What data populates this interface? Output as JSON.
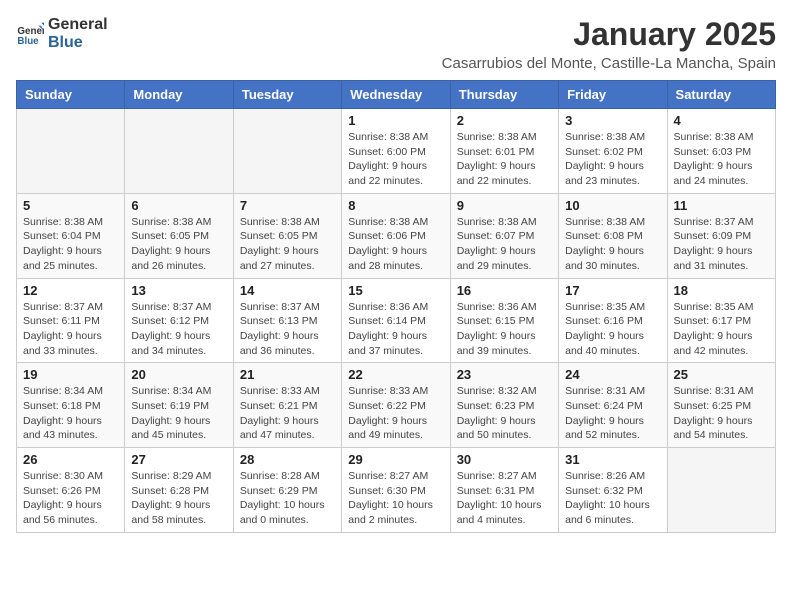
{
  "header": {
    "logo_line1": "General",
    "logo_line2": "Blue",
    "month": "January 2025",
    "location": "Casarrubios del Monte, Castille-La Mancha, Spain"
  },
  "weekdays": [
    "Sunday",
    "Monday",
    "Tuesday",
    "Wednesday",
    "Thursday",
    "Friday",
    "Saturday"
  ],
  "weeks": [
    [
      {
        "day": "",
        "sunrise": "",
        "sunset": "",
        "daylight": ""
      },
      {
        "day": "",
        "sunrise": "",
        "sunset": "",
        "daylight": ""
      },
      {
        "day": "",
        "sunrise": "",
        "sunset": "",
        "daylight": ""
      },
      {
        "day": "1",
        "sunrise": "Sunrise: 8:38 AM",
        "sunset": "Sunset: 6:00 PM",
        "daylight": "Daylight: 9 hours and 22 minutes."
      },
      {
        "day": "2",
        "sunrise": "Sunrise: 8:38 AM",
        "sunset": "Sunset: 6:01 PM",
        "daylight": "Daylight: 9 hours and 22 minutes."
      },
      {
        "day": "3",
        "sunrise": "Sunrise: 8:38 AM",
        "sunset": "Sunset: 6:02 PM",
        "daylight": "Daylight: 9 hours and 23 minutes."
      },
      {
        "day": "4",
        "sunrise": "Sunrise: 8:38 AM",
        "sunset": "Sunset: 6:03 PM",
        "daylight": "Daylight: 9 hours and 24 minutes."
      }
    ],
    [
      {
        "day": "5",
        "sunrise": "Sunrise: 8:38 AM",
        "sunset": "Sunset: 6:04 PM",
        "daylight": "Daylight: 9 hours and 25 minutes."
      },
      {
        "day": "6",
        "sunrise": "Sunrise: 8:38 AM",
        "sunset": "Sunset: 6:05 PM",
        "daylight": "Daylight: 9 hours and 26 minutes."
      },
      {
        "day": "7",
        "sunrise": "Sunrise: 8:38 AM",
        "sunset": "Sunset: 6:05 PM",
        "daylight": "Daylight: 9 hours and 27 minutes."
      },
      {
        "day": "8",
        "sunrise": "Sunrise: 8:38 AM",
        "sunset": "Sunset: 6:06 PM",
        "daylight": "Daylight: 9 hours and 28 minutes."
      },
      {
        "day": "9",
        "sunrise": "Sunrise: 8:38 AM",
        "sunset": "Sunset: 6:07 PM",
        "daylight": "Daylight: 9 hours and 29 minutes."
      },
      {
        "day": "10",
        "sunrise": "Sunrise: 8:38 AM",
        "sunset": "Sunset: 6:08 PM",
        "daylight": "Daylight: 9 hours and 30 minutes."
      },
      {
        "day": "11",
        "sunrise": "Sunrise: 8:37 AM",
        "sunset": "Sunset: 6:09 PM",
        "daylight": "Daylight: 9 hours and 31 minutes."
      }
    ],
    [
      {
        "day": "12",
        "sunrise": "Sunrise: 8:37 AM",
        "sunset": "Sunset: 6:11 PM",
        "daylight": "Daylight: 9 hours and 33 minutes."
      },
      {
        "day": "13",
        "sunrise": "Sunrise: 8:37 AM",
        "sunset": "Sunset: 6:12 PM",
        "daylight": "Daylight: 9 hours and 34 minutes."
      },
      {
        "day": "14",
        "sunrise": "Sunrise: 8:37 AM",
        "sunset": "Sunset: 6:13 PM",
        "daylight": "Daylight: 9 hours and 36 minutes."
      },
      {
        "day": "15",
        "sunrise": "Sunrise: 8:36 AM",
        "sunset": "Sunset: 6:14 PM",
        "daylight": "Daylight: 9 hours and 37 minutes."
      },
      {
        "day": "16",
        "sunrise": "Sunrise: 8:36 AM",
        "sunset": "Sunset: 6:15 PM",
        "daylight": "Daylight: 9 hours and 39 minutes."
      },
      {
        "day": "17",
        "sunrise": "Sunrise: 8:35 AM",
        "sunset": "Sunset: 6:16 PM",
        "daylight": "Daylight: 9 hours and 40 minutes."
      },
      {
        "day": "18",
        "sunrise": "Sunrise: 8:35 AM",
        "sunset": "Sunset: 6:17 PM",
        "daylight": "Daylight: 9 hours and 42 minutes."
      }
    ],
    [
      {
        "day": "19",
        "sunrise": "Sunrise: 8:34 AM",
        "sunset": "Sunset: 6:18 PM",
        "daylight": "Daylight: 9 hours and 43 minutes."
      },
      {
        "day": "20",
        "sunrise": "Sunrise: 8:34 AM",
        "sunset": "Sunset: 6:19 PM",
        "daylight": "Daylight: 9 hours and 45 minutes."
      },
      {
        "day": "21",
        "sunrise": "Sunrise: 8:33 AM",
        "sunset": "Sunset: 6:21 PM",
        "daylight": "Daylight: 9 hours and 47 minutes."
      },
      {
        "day": "22",
        "sunrise": "Sunrise: 8:33 AM",
        "sunset": "Sunset: 6:22 PM",
        "daylight": "Daylight: 9 hours and 49 minutes."
      },
      {
        "day": "23",
        "sunrise": "Sunrise: 8:32 AM",
        "sunset": "Sunset: 6:23 PM",
        "daylight": "Daylight: 9 hours and 50 minutes."
      },
      {
        "day": "24",
        "sunrise": "Sunrise: 8:31 AM",
        "sunset": "Sunset: 6:24 PM",
        "daylight": "Daylight: 9 hours and 52 minutes."
      },
      {
        "day": "25",
        "sunrise": "Sunrise: 8:31 AM",
        "sunset": "Sunset: 6:25 PM",
        "daylight": "Daylight: 9 hours and 54 minutes."
      }
    ],
    [
      {
        "day": "26",
        "sunrise": "Sunrise: 8:30 AM",
        "sunset": "Sunset: 6:26 PM",
        "daylight": "Daylight: 9 hours and 56 minutes."
      },
      {
        "day": "27",
        "sunrise": "Sunrise: 8:29 AM",
        "sunset": "Sunset: 6:28 PM",
        "daylight": "Daylight: 9 hours and 58 minutes."
      },
      {
        "day": "28",
        "sunrise": "Sunrise: 8:28 AM",
        "sunset": "Sunset: 6:29 PM",
        "daylight": "Daylight: 10 hours and 0 minutes."
      },
      {
        "day": "29",
        "sunrise": "Sunrise: 8:27 AM",
        "sunset": "Sunset: 6:30 PM",
        "daylight": "Daylight: 10 hours and 2 minutes."
      },
      {
        "day": "30",
        "sunrise": "Sunrise: 8:27 AM",
        "sunset": "Sunset: 6:31 PM",
        "daylight": "Daylight: 10 hours and 4 minutes."
      },
      {
        "day": "31",
        "sunrise": "Sunrise: 8:26 AM",
        "sunset": "Sunset: 6:32 PM",
        "daylight": "Daylight: 10 hours and 6 minutes."
      },
      {
        "day": "",
        "sunrise": "",
        "sunset": "",
        "daylight": ""
      }
    ]
  ]
}
